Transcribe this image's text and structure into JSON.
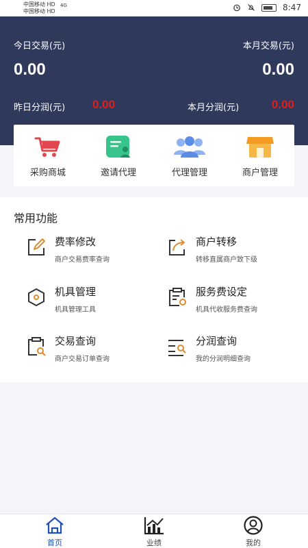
{
  "status_bar": {
    "carrier1": "中国移动 HD",
    "carrier2": "中国移动 HD",
    "network1": "4G",
    "network2": "4G",
    "time": "8:47"
  },
  "stats": {
    "today_label": "今日交易(元)",
    "today_value": "0.00",
    "month_label": "本月交易(元)",
    "month_value": "0.00",
    "yesterday_share_label": "昨日分润(元)",
    "yesterday_share_value": "0.00",
    "month_share_label": "本月分润(元)",
    "month_share_value": "0.00",
    "accent_color": "#e21b1b",
    "header_color": "#2f395c"
  },
  "quick_actions": [
    {
      "label": "采购商城",
      "icon": "cart-icon"
    },
    {
      "label": "邀请代理",
      "icon": "invite-card-icon"
    },
    {
      "label": "代理管理",
      "icon": "group-icon"
    },
    {
      "label": "商户管理",
      "icon": "shop-icon"
    }
  ],
  "common": {
    "title": "常用功能",
    "items": [
      {
        "title": "费率修改",
        "desc": "商户交易费率查询",
        "icon": "edit-icon"
      },
      {
        "title": "商户转移",
        "desc": "转移直属商户致下级",
        "icon": "transfer-icon"
      },
      {
        "title": "机具管理",
        "desc": "机具管理工具",
        "icon": "device-icon"
      },
      {
        "title": "服务费设定",
        "desc": "机具代收服务费查询",
        "icon": "fee-clipboard-icon"
      },
      {
        "title": "交易查询",
        "desc": "商户交易订单查询",
        "icon": "search-clipboard-icon"
      },
      {
        "title": "分润查询",
        "desc": "我的分润明细查询",
        "icon": "list-search-icon"
      }
    ]
  },
  "tabs": [
    {
      "label": "首页",
      "icon": "home-icon",
      "active": true
    },
    {
      "label": "业绩",
      "icon": "chart-icon",
      "active": false
    },
    {
      "label": "我的",
      "icon": "user-icon",
      "active": false
    }
  ]
}
